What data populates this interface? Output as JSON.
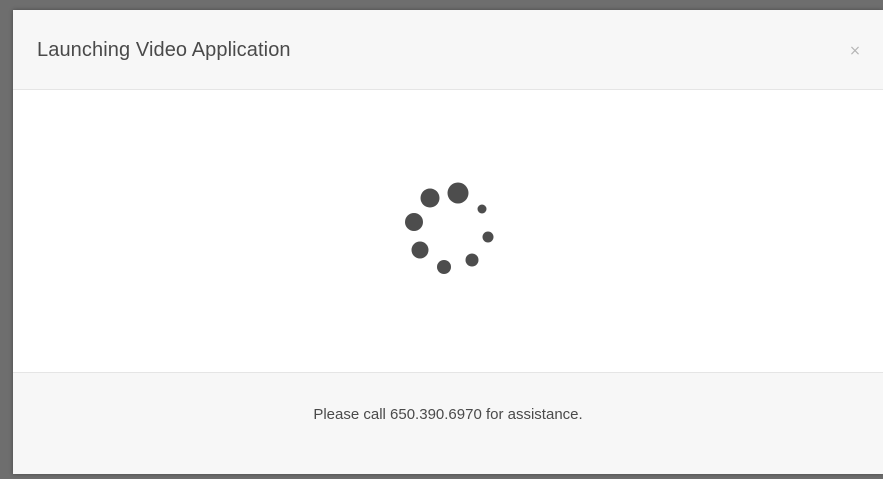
{
  "dialog": {
    "title": "Launching Video Application",
    "close_label": "×"
  },
  "body": {
    "spinner_icon": "loading-spinner-icon"
  },
  "footer": {
    "message": "Please call 650.390.6970 for assistance."
  },
  "colors": {
    "backdrop": "#6e6e6e",
    "header_bg": "#f7f7f7",
    "body_bg": "#ffffff",
    "text": "#4a4a4a",
    "spinner": "#4d4d4d"
  }
}
